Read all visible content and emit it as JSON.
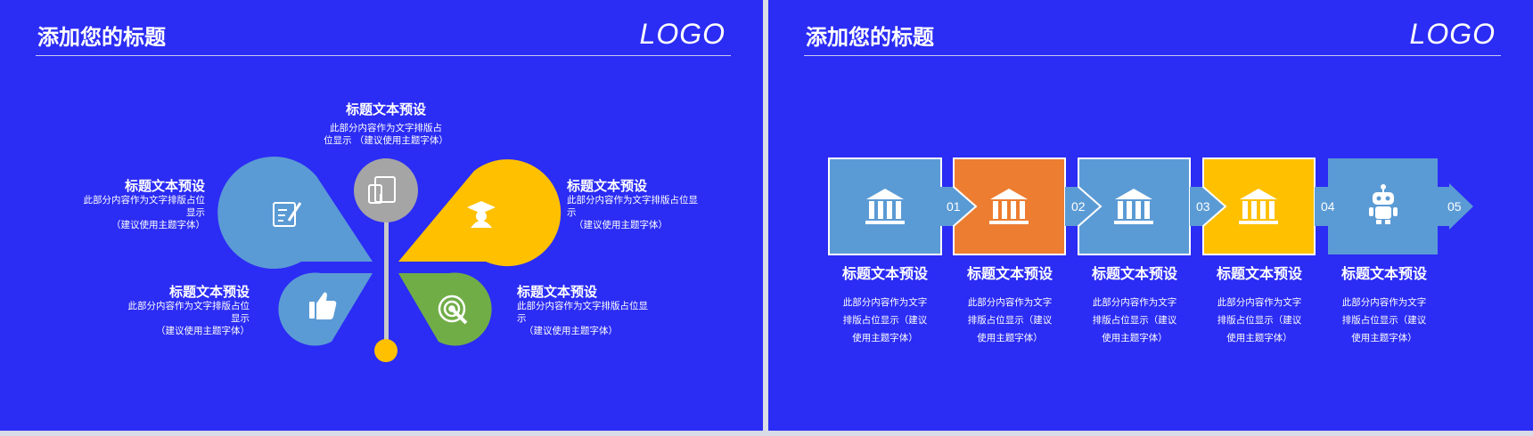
{
  "slide1": {
    "title": "添加您的标题",
    "logo": "LOGO",
    "items": [
      {
        "title": "标题文本预设",
        "body_lines": [
          "此部分内容作为文字排版占",
          "位显示 （建议使用主题字体）"
        ]
      },
      {
        "title": "标题文本预设",
        "body_lines": [
          "此部分内容作为文字排版占位",
          "显示",
          "（建议使用主题字体）"
        ]
      },
      {
        "title": "标题文本预设",
        "body_lines": [
          "此部分内容作为文字排版占位显",
          "示",
          "（建议使用主题字体）"
        ]
      },
      {
        "title": "标题文本预设",
        "body_lines": [
          "此部分内容作为文字排版占位",
          "显示",
          "（建议使用主题字体）"
        ]
      },
      {
        "title": "标题文本预设",
        "body_lines": [
          "此部分内容作为文字排版占位显",
          "示",
          "（建议使用主题字体）"
        ]
      }
    ],
    "colors": {
      "blue_petal": "#5b9bd5",
      "yellow_petal": "#ffc000",
      "green_petal": "#70ad47",
      "gray_circle": "#a5a5a5",
      "stem_dot": "#ffc000"
    }
  },
  "slide2": {
    "title": "添加您的标题",
    "logo": "LOGO",
    "steps": [
      {
        "num": "01",
        "icon": "bank-icon",
        "color": "#5b9bd5",
        "title": "标题文本预设",
        "body_lines": [
          "此部分内容作为文字",
          "排版占位显示（建议",
          "使用主题字体）"
        ]
      },
      {
        "num": "02",
        "icon": "bank-icon",
        "color": "#ed7d31",
        "title": "标题文本预设",
        "body_lines": [
          "此部分内容作为文字",
          "排版占位显示（建议",
          "使用主题字体）"
        ]
      },
      {
        "num": "03",
        "icon": "bank-icon",
        "color": "#5b9bd5",
        "title": "标题文本预设",
        "body_lines": [
          "此部分内容作为文字",
          "排版占位显示（建议",
          "使用主题字体）"
        ]
      },
      {
        "num": "04",
        "icon": "bank-icon",
        "color": "#ffc000",
        "title": "标题文本预设",
        "body_lines": [
          "此部分内容作为文字",
          "排版占位显示（建议",
          "使用主题字体）"
        ]
      },
      {
        "num": "05",
        "icon": "robot-icon",
        "color": "#5b9bd5",
        "title": "标题文本预设",
        "body_lines": [
          "此部分内容作为文字",
          "排版占位显示（建议",
          "使用主题字体）"
        ]
      }
    ]
  }
}
